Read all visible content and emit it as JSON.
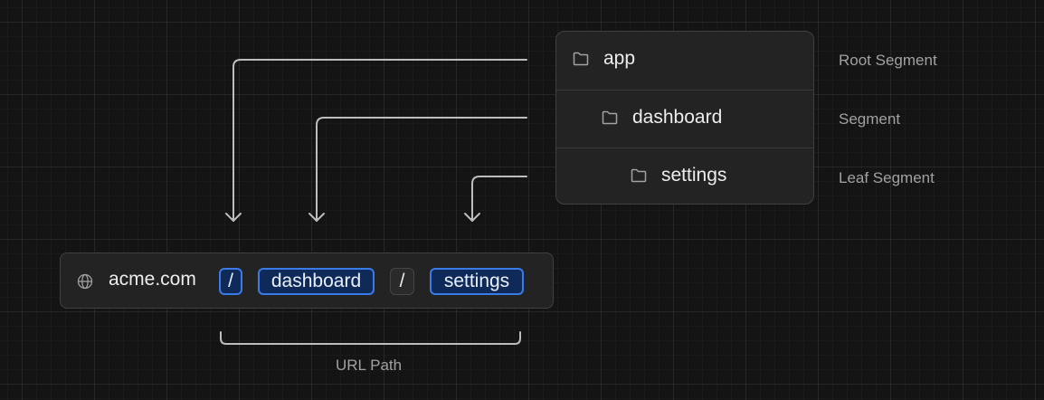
{
  "tree": {
    "items": [
      {
        "label": "app",
        "icon": "folder-icon"
      },
      {
        "label": "dashboard",
        "icon": "folder-icon"
      },
      {
        "label": "settings",
        "icon": "folder-icon"
      }
    ]
  },
  "segment_labels": [
    "Root Segment",
    "Segment",
    "Leaf Segment"
  ],
  "url": {
    "domain": "acme.com",
    "icon": "globe-icon",
    "segments": [
      "/",
      "dashboard",
      "/",
      "settings"
    ]
  },
  "bracket_label": "URL Path",
  "colors": {
    "background": "#141414",
    "highlight_border": "#3b7be8",
    "highlight_fill": "#0f2a59",
    "line": "#bdbdbd"
  }
}
